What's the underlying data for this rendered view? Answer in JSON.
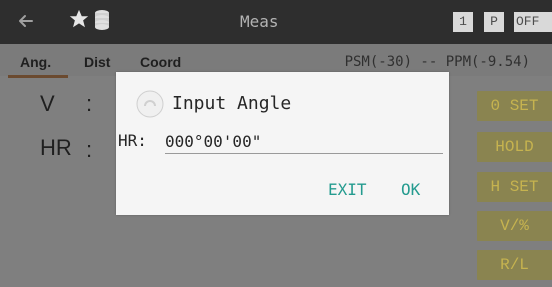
{
  "topbar": {
    "title": "Meas",
    "badges": [
      "1",
      "P",
      "OFF"
    ],
    "icons": [
      "back-arrow",
      "star",
      "database"
    ]
  },
  "tabs": {
    "items": [
      "Ang.",
      "Dist",
      "Coord"
    ],
    "active": "Ang."
  },
  "status": {
    "text": "PSM(-30) -- PPM(-9.54)"
  },
  "main": {
    "labels": [
      "V",
      ":",
      "HR",
      ":"
    ],
    "side_buttons": [
      "0 SET",
      "HOLD",
      "H SET",
      "V/%",
      "R/L"
    ]
  },
  "dialog": {
    "title": "Input Angle",
    "field_label": "HR:",
    "field_value": "000°00'00\"",
    "buttons": [
      "EXIT",
      "OK"
    ]
  },
  "colors": {
    "topbar": "#2e2e2e",
    "panel": "#7f7f7f",
    "dialog": "#f5f5f5",
    "accent": "#249b8f",
    "side_button_bg": "#8a8450",
    "side_button_text": "#c6b34f",
    "tab_underline": "#6b4a2f"
  }
}
